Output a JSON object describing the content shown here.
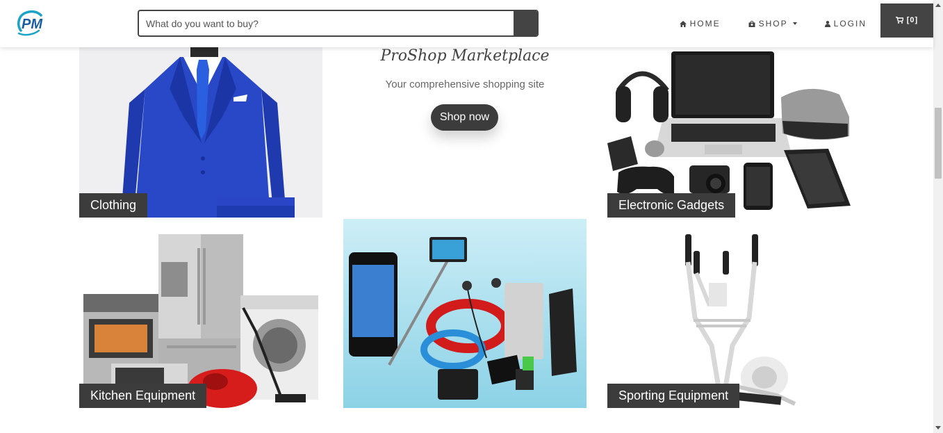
{
  "brand": {
    "logo_text": "PM",
    "accent": "#1aa3c8",
    "dark": "#444444"
  },
  "search": {
    "placeholder": "What do you want to buy?"
  },
  "nav": {
    "home": "HOME",
    "shop": "SHOP",
    "login": "LOGIN",
    "cart": "[0]"
  },
  "hero": {
    "title": "ProShop Marketplace",
    "subtitle": "Your comprehensive shopping site",
    "cta": "Shop now"
  },
  "categories": [
    {
      "label": "Clothing",
      "image": "blue-suit"
    },
    {
      "label": "Electronic Gadgets",
      "image": "laptop-headphones-gadgets"
    },
    {
      "label": "Kitchen Equipment",
      "image": "fridge-oven-washer"
    },
    {
      "label": "",
      "image": "phone-accessories"
    },
    {
      "label": "Sporting Equipment",
      "image": "elliptical-trainer"
    }
  ]
}
